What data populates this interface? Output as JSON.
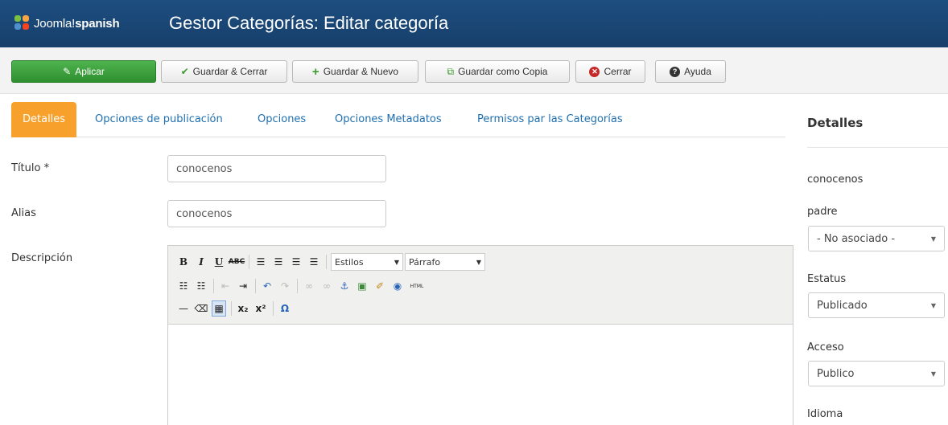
{
  "header": {
    "logo_prefix": "Joomla!",
    "logo_suffix": "spanish",
    "title": "Gestor Categorías: Editar categoría"
  },
  "toolbar": {
    "apply": "Aplicar",
    "save_close": "Guardar & Cerrar",
    "save_new": "Guardar & Nuevo",
    "save_copy": "Guardar como Copia",
    "close": "Cerrar",
    "help": "Ayuda"
  },
  "tabs": [
    {
      "label": "Detalles",
      "active": true
    },
    {
      "label": "Opciones de publicación"
    },
    {
      "label": "Opciones"
    },
    {
      "label": "Opciones Metadatos"
    },
    {
      "label": "Permisos par las Categorías"
    }
  ],
  "form": {
    "title_label": "Título *",
    "title_value": "conocenos",
    "alias_label": "Alias",
    "alias_value": "conocenos",
    "description_label": "Descripción"
  },
  "editor": {
    "styles_select": "Estilos",
    "format_select": "Párrafo",
    "html_button": "HTML"
  },
  "sidebar": {
    "title": "Detalles",
    "item_name": "conocenos",
    "parent_label": "padre",
    "parent_value": "- No asociado -",
    "status_label": "Estatus",
    "status_value": "Publicado",
    "access_label": "Acceso",
    "access_value": "Publico",
    "language_label": "Idioma"
  },
  "colors": {
    "header_bg": "#1d4e80",
    "apply_green": "#3c9f3c",
    "active_tab": "#f7a02b",
    "link_blue": "#1f6fb0"
  }
}
